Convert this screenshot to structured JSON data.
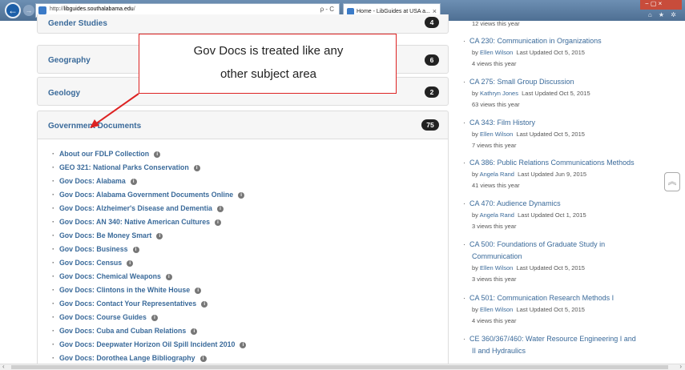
{
  "browser": {
    "url_prefix": "http://",
    "url_host": "libguides.southalabama.edu",
    "url_suffix": "/",
    "address_tools": "ρ - C",
    "tab_label": "Home - LibGuides at USA a...",
    "tab_close": "×",
    "window_buttons": "− ▢ ×",
    "toolbar_icons": "⌂ ★ ✲",
    "back_glyph": "←",
    "forward_glyph": "→"
  },
  "subjects": [
    {
      "name": "Gender Studies",
      "count": "4"
    },
    {
      "name": "Geography",
      "count": "6"
    },
    {
      "name": "Geology",
      "count": "2"
    },
    {
      "name": "Government Documents",
      "count": "75"
    }
  ],
  "gov_docs_items": [
    "About our FDLP Collection",
    "GEO 321: National Parks Conservation",
    "Gov Docs: Alabama",
    "Gov Docs: Alabama Government Documents Online",
    "Gov Docs: Alzheimer's Disease and Dementia",
    "Gov Docs: AN 340: Native American Cultures",
    "Gov Docs: Be Money Smart",
    "Gov Docs: Business",
    "Gov Docs: Census",
    "Gov Docs: Chemical Weapons",
    "Gov Docs: Clintons in the White House",
    "Gov Docs: Contact Your Representatives",
    "Gov Docs: Course Guides",
    "Gov Docs: Cuba and Cuban Relations",
    "Gov Docs: Deepwater Horizon Oil Spill Incident 2010",
    "Gov Docs: Dorothea Lange Bibliography"
  ],
  "right_top_partial": "12 views this year",
  "guides": [
    {
      "title": "CA 230: Communication in Organizations",
      "author": "Ellen Wilson",
      "updated": "Last Updated Oct 5, 2015",
      "views": "4 views this year"
    },
    {
      "title": "CA 275: Small Group Discussion",
      "author": "Kathryn Jones",
      "updated": "Last Updated Oct 5, 2015",
      "views": "63 views this year"
    },
    {
      "title": "CA 343: Film History",
      "author": "Ellen Wilson",
      "updated": "Last Updated Oct 5, 2015",
      "views": "7 views this year"
    },
    {
      "title": "CA 386: Public Relations Communications Methods",
      "author": "Angela Rand",
      "updated": "Last Updated Jun 9, 2015",
      "views": "41 views this year"
    },
    {
      "title": "CA 470: Audience Dynamics",
      "author": "Angela Rand",
      "updated": "Last Updated Oct 1, 2015",
      "views": "3 views this year"
    },
    {
      "title": "CA 500: Foundations of Graduate Study in",
      "title2": "Communication",
      "author": "Ellen Wilson",
      "updated": "Last Updated Oct 5, 2015",
      "views": "3 views this year"
    },
    {
      "title": "CA 501: Communication Research Methods I",
      "author": "Ellen Wilson",
      "updated": "Last Updated Oct 5, 2015",
      "views": "4 views this year"
    },
    {
      "title": "CE 360/367/460: Water Resource Engineering I and",
      "title2": "II and Hydraulics"
    }
  ],
  "by_label": "by",
  "callout": {
    "line1": "Gov Docs is treated like any",
    "line2": "other subject area",
    "border_color": "#dd2222"
  },
  "scroll_top_glyph": "≈",
  "colors": {
    "link": "#3a6a9a",
    "badge": "#222222",
    "accent_red": "#dd2222"
  }
}
